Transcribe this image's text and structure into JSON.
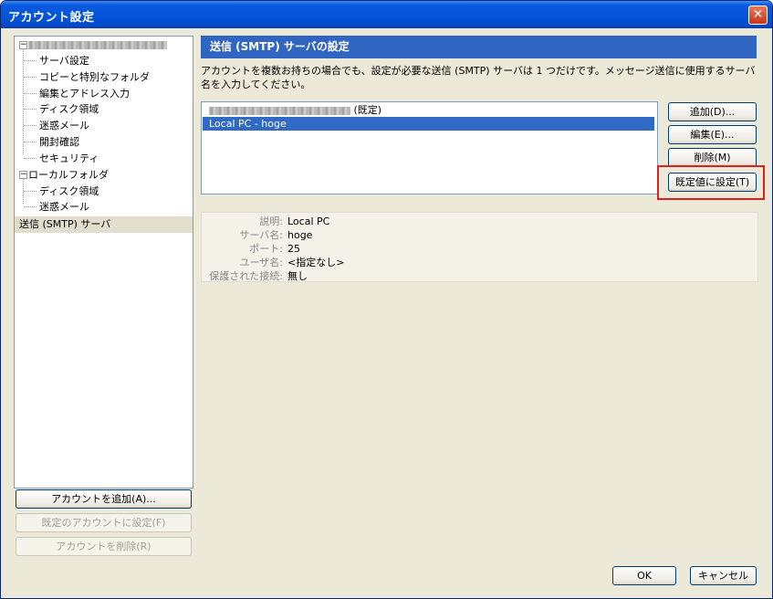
{
  "window": {
    "title": "アカウント設定",
    "close_glyph": "✕"
  },
  "tree": {
    "account": {
      "toggle": "−",
      "items": [
        "サーバ設定",
        "コピーと特別なフォルダ",
        "編集とアドレス入力",
        "ディスク領域",
        "迷惑メール",
        "開封確認",
        "セキュリティ"
      ]
    },
    "local": {
      "toggle": "−",
      "label": "ローカルフォルダ",
      "items": [
        "ディスク領域",
        "迷惑メール"
      ]
    },
    "smtp": {
      "label": "送信 (SMTP) サーバ"
    }
  },
  "left_buttons": {
    "add_account": "アカウントを追加(A)...",
    "set_default": "既定のアカウントに設定(F)",
    "remove_account": "アカウントを削除(R)"
  },
  "smtp_panel": {
    "header": "送信 (SMTP) サーバの設定",
    "description": "アカウントを複数お持ちの場合でも、設定が必要な送信 (SMTP) サーバは 1 つだけです。メッセージ送信に使用するサーバ名を入力してください。",
    "servers": [
      {
        "suffix": "(既定)"
      },
      {
        "label": "Local PC - hoge"
      }
    ],
    "buttons": {
      "add": "追加(D)...",
      "edit": "編集(E)...",
      "delete": "削除(M)",
      "set_default": "既定値に設定(T)"
    },
    "details": {
      "description_label": "説明:",
      "description_value": "Local PC",
      "server_label": "サーバ名:",
      "server_value": "hoge",
      "port_label": "ポート:",
      "port_value": "25",
      "user_label": "ユーザ名:",
      "user_value": "<指定なし>",
      "secure_label": "保護された接続:",
      "secure_value": "無し"
    }
  },
  "footer": {
    "ok": "OK",
    "cancel": "キャンセル"
  },
  "colors": {
    "title_blue": "#0554d8",
    "header_blue": "#3165c2",
    "selection": "#316ac5",
    "highlight_red": "#e02020"
  }
}
